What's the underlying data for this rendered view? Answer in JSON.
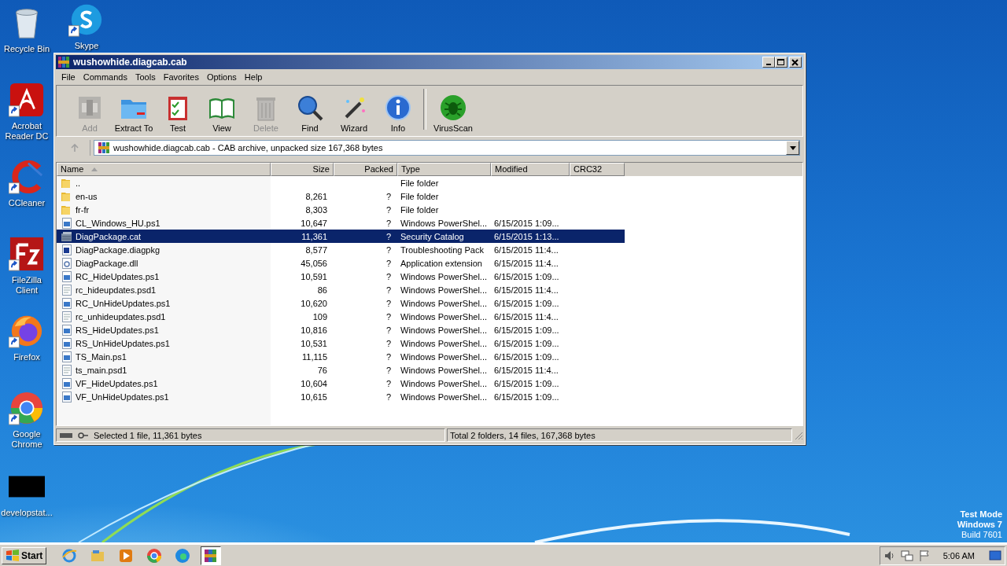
{
  "desktop_icons": [
    {
      "label": "Recycle Bin",
      "kind": "recycle",
      "shortcut": false
    },
    {
      "label": "Skype",
      "kind": "skype",
      "shortcut": true
    },
    {
      "label": "Acrobat Reader DC",
      "kind": "acrobat",
      "shortcut": true
    },
    {
      "label": "CCleaner",
      "kind": "ccleaner",
      "shortcut": true
    },
    {
      "label": "FileZilla Client",
      "kind": "filezilla",
      "shortcut": true
    },
    {
      "label": "Firefox",
      "kind": "firefox",
      "shortcut": true
    },
    {
      "label": "Google Chrome",
      "kind": "chrome",
      "shortcut": true
    },
    {
      "label": "developstat...",
      "kind": "blank",
      "shortcut": false
    }
  ],
  "window": {
    "title": "wushowhide.diagcab.cab",
    "menu": [
      "File",
      "Commands",
      "Tools",
      "Favorites",
      "Options",
      "Help"
    ],
    "toolbar_groups": [
      [
        {
          "label": "Add",
          "kind": "add",
          "disabled": true
        },
        {
          "label": "Extract To",
          "kind": "extract",
          "disabled": false
        },
        {
          "label": "Test",
          "kind": "test",
          "disabled": false
        },
        {
          "label": "View",
          "kind": "view",
          "disabled": false
        },
        {
          "label": "Delete",
          "kind": "delete",
          "disabled": true
        },
        {
          "label": "Find",
          "kind": "find",
          "disabled": false
        },
        {
          "label": "Wizard",
          "kind": "wizard",
          "disabled": false
        },
        {
          "label": "Info",
          "kind": "info",
          "disabled": false
        }
      ],
      [
        {
          "label": "VirusScan",
          "kind": "virus",
          "disabled": false
        }
      ]
    ],
    "address": "wushowhide.diagcab.cab - CAB archive, unpacked size 167,368 bytes",
    "columns": [
      "Name",
      "Size",
      "Packed",
      "Type",
      "Modified",
      "CRC32"
    ],
    "rows": [
      {
        "name": "..",
        "type": "File folder",
        "kind": "folder",
        "selected": false
      },
      {
        "name": "en-us",
        "size": "8,261",
        "packed": "?",
        "type": "File folder",
        "kind": "folder",
        "selected": false
      },
      {
        "name": "fr-fr",
        "size": "8,303",
        "packed": "?",
        "type": "File folder",
        "kind": "folder",
        "selected": false
      },
      {
        "name": "CL_Windows_HU.ps1",
        "size": "10,647",
        "packed": "?",
        "type": "Windows PowerShel...",
        "modified": "6/15/2015 1:09...",
        "kind": "script",
        "selected": false
      },
      {
        "name": "DiagPackage.cat",
        "size": "11,361",
        "packed": "?",
        "type": "Security Catalog",
        "modified": "6/15/2015 1:13...",
        "kind": "catalog",
        "selected": true
      },
      {
        "name": "DiagPackage.diagpkg",
        "size": "8,577",
        "packed": "?",
        "type": "Troubleshooting Pack",
        "modified": "6/15/2015 11:4...",
        "kind": "package",
        "selected": false
      },
      {
        "name": "DiagPackage.dll",
        "size": "45,056",
        "packed": "?",
        "type": "Application extension",
        "modified": "6/15/2015 11:4...",
        "kind": "dll",
        "selected": false
      },
      {
        "name": "RC_HideUpdates.ps1",
        "size": "10,591",
        "packed": "?",
        "type": "Windows PowerShel...",
        "modified": "6/15/2015 1:09...",
        "kind": "script",
        "selected": false
      },
      {
        "name": "rc_hideupdates.psd1",
        "size": "86",
        "packed": "?",
        "type": "Windows PowerShel...",
        "modified": "6/15/2015 11:4...",
        "kind": "document",
        "selected": false
      },
      {
        "name": "RC_UnHideUpdates.ps1",
        "size": "10,620",
        "packed": "?",
        "type": "Windows PowerShel...",
        "modified": "6/15/2015 1:09...",
        "kind": "script",
        "selected": false
      },
      {
        "name": "rc_unhideupdates.psd1",
        "size": "109",
        "packed": "?",
        "type": "Windows PowerShel...",
        "modified": "6/15/2015 11:4...",
        "kind": "document",
        "selected": false
      },
      {
        "name": "RS_HideUpdates.ps1",
        "size": "10,816",
        "packed": "?",
        "type": "Windows PowerShel...",
        "modified": "6/15/2015 1:09...",
        "kind": "script",
        "selected": false
      },
      {
        "name": "RS_UnHideUpdates.ps1",
        "size": "10,531",
        "packed": "?",
        "type": "Windows PowerShel...",
        "modified": "6/15/2015 1:09...",
        "kind": "script",
        "selected": false
      },
      {
        "name": "TS_Main.ps1",
        "size": "11,115",
        "packed": "?",
        "type": "Windows PowerShel...",
        "modified": "6/15/2015 1:09...",
        "kind": "script",
        "selected": false
      },
      {
        "name": "ts_main.psd1",
        "size": "76",
        "packed": "?",
        "type": "Windows PowerShel...",
        "modified": "6/15/2015 11:4...",
        "kind": "document",
        "selected": false
      },
      {
        "name": "VF_HideUpdates.ps1",
        "size": "10,604",
        "packed": "?",
        "type": "Windows PowerShel...",
        "modified": "6/15/2015 1:09...",
        "kind": "script",
        "selected": false
      },
      {
        "name": "VF_UnHideUpdates.ps1",
        "size": "10,615",
        "packed": "?",
        "type": "Windows PowerShel...",
        "modified": "6/15/2015 1:09...",
        "kind": "script",
        "selected": false
      }
    ],
    "status_left": "Selected 1 file, 11,361 bytes",
    "status_right": "Total 2 folders, 14 files, 167,368 bytes"
  },
  "os_notice": [
    "Test Mode",
    "Windows 7",
    "Build 7601"
  ],
  "taskbar": {
    "start": "Start",
    "apps": [
      {
        "kind": "ie",
        "active": false
      },
      {
        "kind": "explorer",
        "active": false
      },
      {
        "kind": "media",
        "active": false
      },
      {
        "kind": "chrome",
        "active": false
      },
      {
        "kind": "edge",
        "active": false
      },
      {
        "kind": "winrar",
        "active": true
      }
    ],
    "clock": "5:06 AM"
  }
}
